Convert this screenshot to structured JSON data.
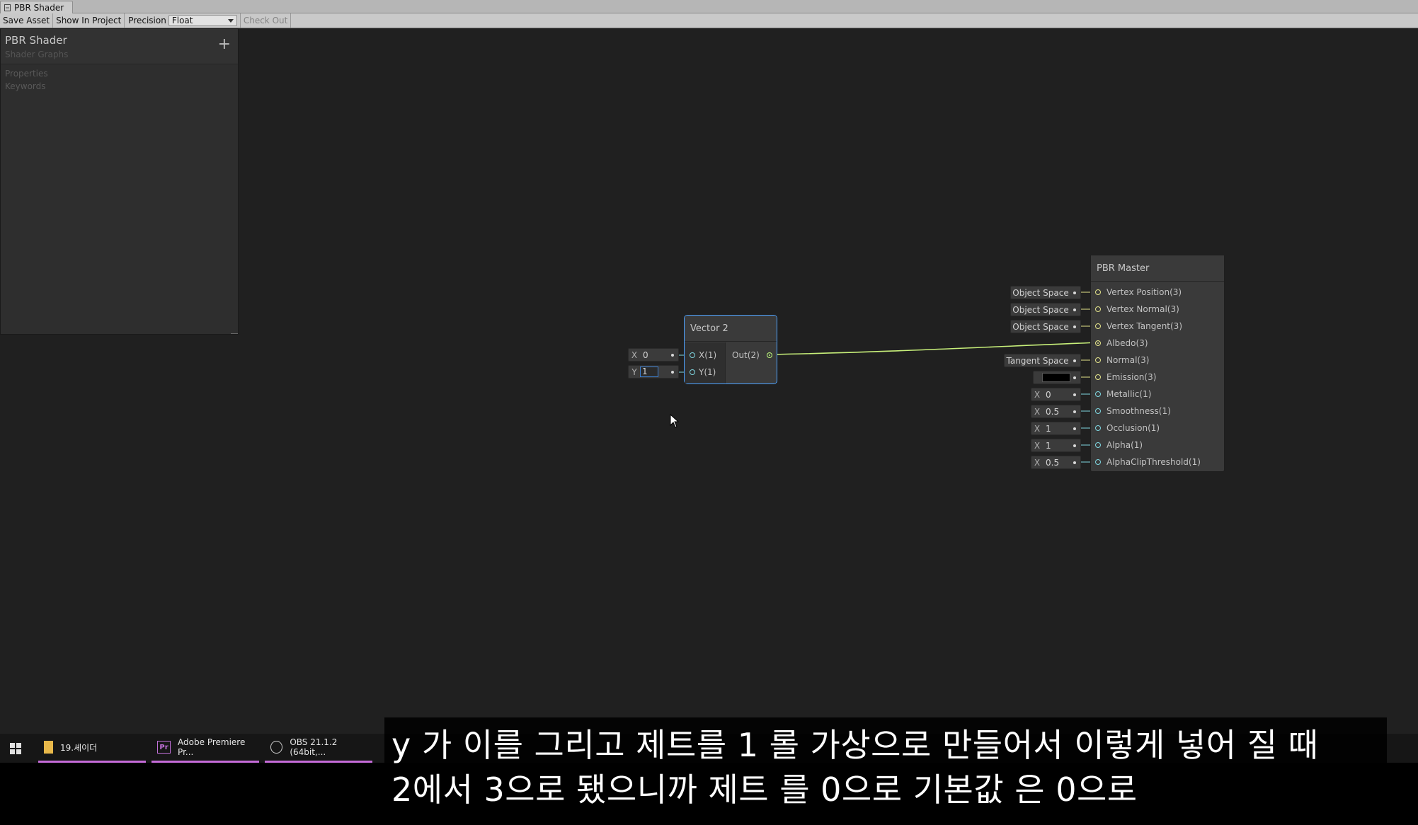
{
  "window": {
    "tab_title": "PBR Shader"
  },
  "toolbar": {
    "save_asset": "Save Asset",
    "show_in_project": "Show In Project",
    "precision_label": "Precision",
    "precision_value": "Float",
    "check_out": "Check Out"
  },
  "blackboard": {
    "title": "PBR Shader",
    "subtitle": "Shader Graphs",
    "add_symbol": "+",
    "sections": [
      "Properties",
      "Keywords"
    ]
  },
  "vector2_node": {
    "title": "Vector 2",
    "inputs": [
      {
        "axis": "X",
        "value": "0",
        "port_label": "X(1)"
      },
      {
        "axis": "Y",
        "value": "1",
        "port_label": "Y(1)"
      }
    ],
    "output_label": "Out(2)"
  },
  "master_node": {
    "title": "PBR Master",
    "ports": [
      {
        "label": "Vertex Position(3)",
        "control": "Object Space"
      },
      {
        "label": "Vertex Normal(3)",
        "control": "Object Space"
      },
      {
        "label": "Vertex Tangent(3)",
        "control": "Object Space"
      },
      {
        "label": "Albedo(3)",
        "control": ""
      },
      {
        "label": "Normal(3)",
        "control": "Tangent Space"
      },
      {
        "label": "Emission(3)",
        "control": ""
      },
      {
        "label": "Metallic(1)",
        "axis": "X",
        "value": "0"
      },
      {
        "label": "Smoothness(1)",
        "axis": "X",
        "value": "0.5"
      },
      {
        "label": "Occlusion(1)",
        "axis": "X",
        "value": "1"
      },
      {
        "label": "Alpha(1)",
        "axis": "X",
        "value": "1"
      },
      {
        "label": "AlphaClipThreshold(1)",
        "axis": "X",
        "value": "0.5"
      }
    ],
    "emission_color": "#000000"
  },
  "colors": {
    "canvas": "#202020",
    "vector_port": "#e3e38a",
    "float_port": "#7fd6e0",
    "edge": "#c8f07a",
    "selection": "#4da2ff"
  },
  "taskbar": {
    "items": [
      {
        "icon": "folder-icon",
        "label": "19.셰이더"
      },
      {
        "icon": "premiere-icon",
        "label": "Adobe Premiere Pr..."
      },
      {
        "icon": "obs-icon",
        "label": "OBS 21.1.2 (64bit,..."
      }
    ]
  },
  "caption": {
    "line1": "y 가 이를 그리고 제트를 1 롤 가상으로 만들어서 이렇게 넣어 질 때",
    "line2": "2에서 3으로 됐으니까 제트 를 0으로 기본값 은 0으로"
  }
}
